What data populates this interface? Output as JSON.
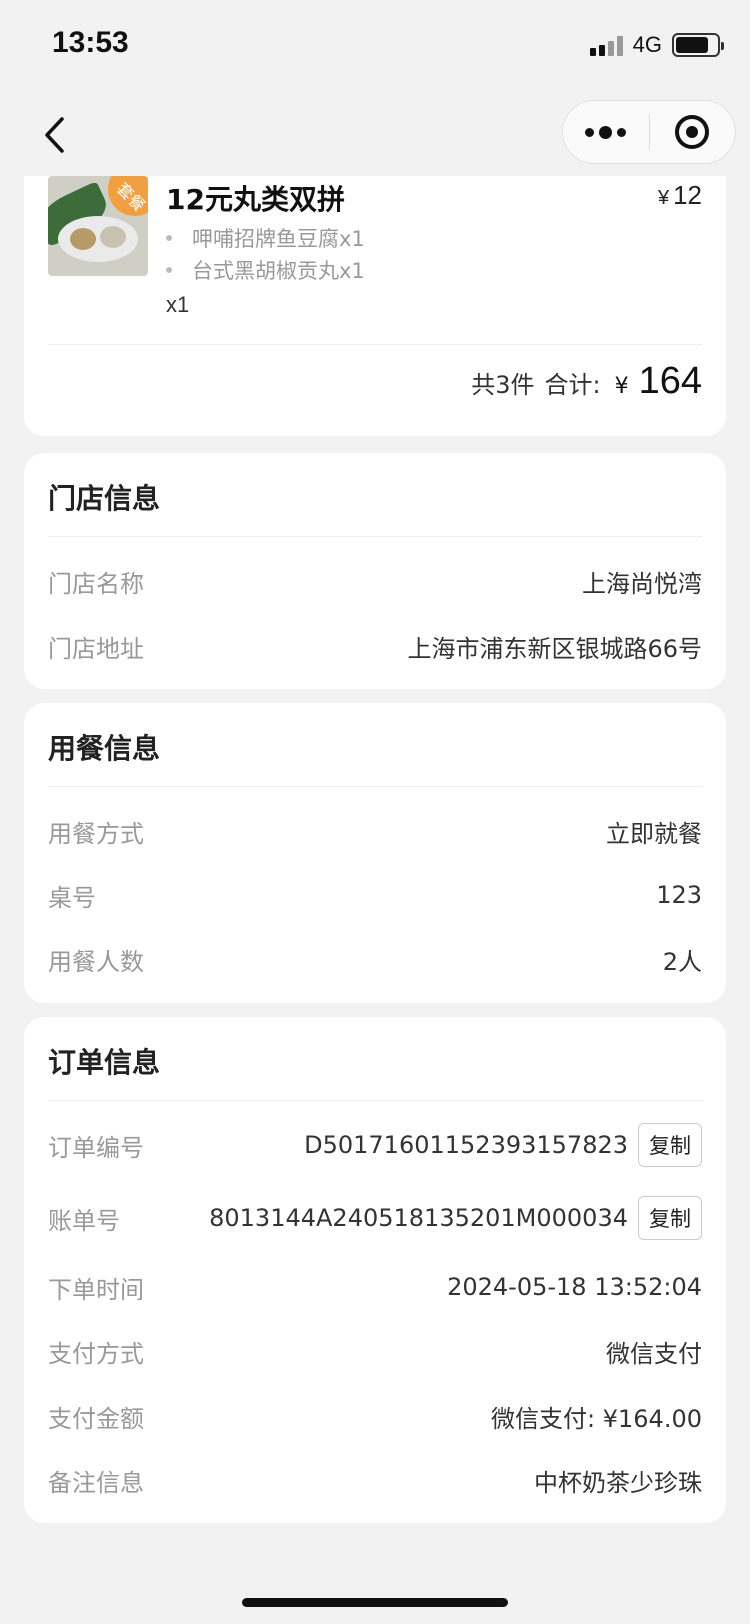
{
  "status_bar": {
    "time": "13:53",
    "network": "4G"
  },
  "goods": {
    "name": "12元丸类双拼",
    "combo_tag": "套餐",
    "price_symbol": "¥",
    "price": "12",
    "sub_items": [
      "呷哺招牌鱼豆腐x1",
      "台式黑胡椒贡丸x1"
    ],
    "quantity": "x1",
    "total_count": "共3件",
    "total_label": "合计:",
    "total_symbol": "¥",
    "total_value": "164"
  },
  "store_info": {
    "title": "门店信息",
    "rows": [
      {
        "label": "门店名称",
        "value": "上海尚悦湾"
      },
      {
        "label": "门店地址",
        "value": "上海市浦东新区银城路66号"
      }
    ]
  },
  "dining_info": {
    "title": "用餐信息",
    "rows": [
      {
        "label": "用餐方式",
        "value": "立即就餐"
      },
      {
        "label": "桌号",
        "value": "123"
      },
      {
        "label": "用餐人数",
        "value": "2人"
      }
    ]
  },
  "order_info": {
    "title": "订单信息",
    "copy_label": "复制",
    "rows": [
      {
        "label": "订单编号",
        "value": "D501716011523931578​23"
      },
      {
        "label": "账单号",
        "value": "8013144A240518135201M000034"
      },
      {
        "label": "下单时间",
        "value": "2024-05-18 13:52:04"
      },
      {
        "label": "支付方式",
        "value": "微信支付"
      },
      {
        "label": "支付金额",
        "value": "微信支付: ¥164.00"
      },
      {
        "label": "备注信息",
        "value": "中杯奶茶少珍珠"
      }
    ]
  }
}
